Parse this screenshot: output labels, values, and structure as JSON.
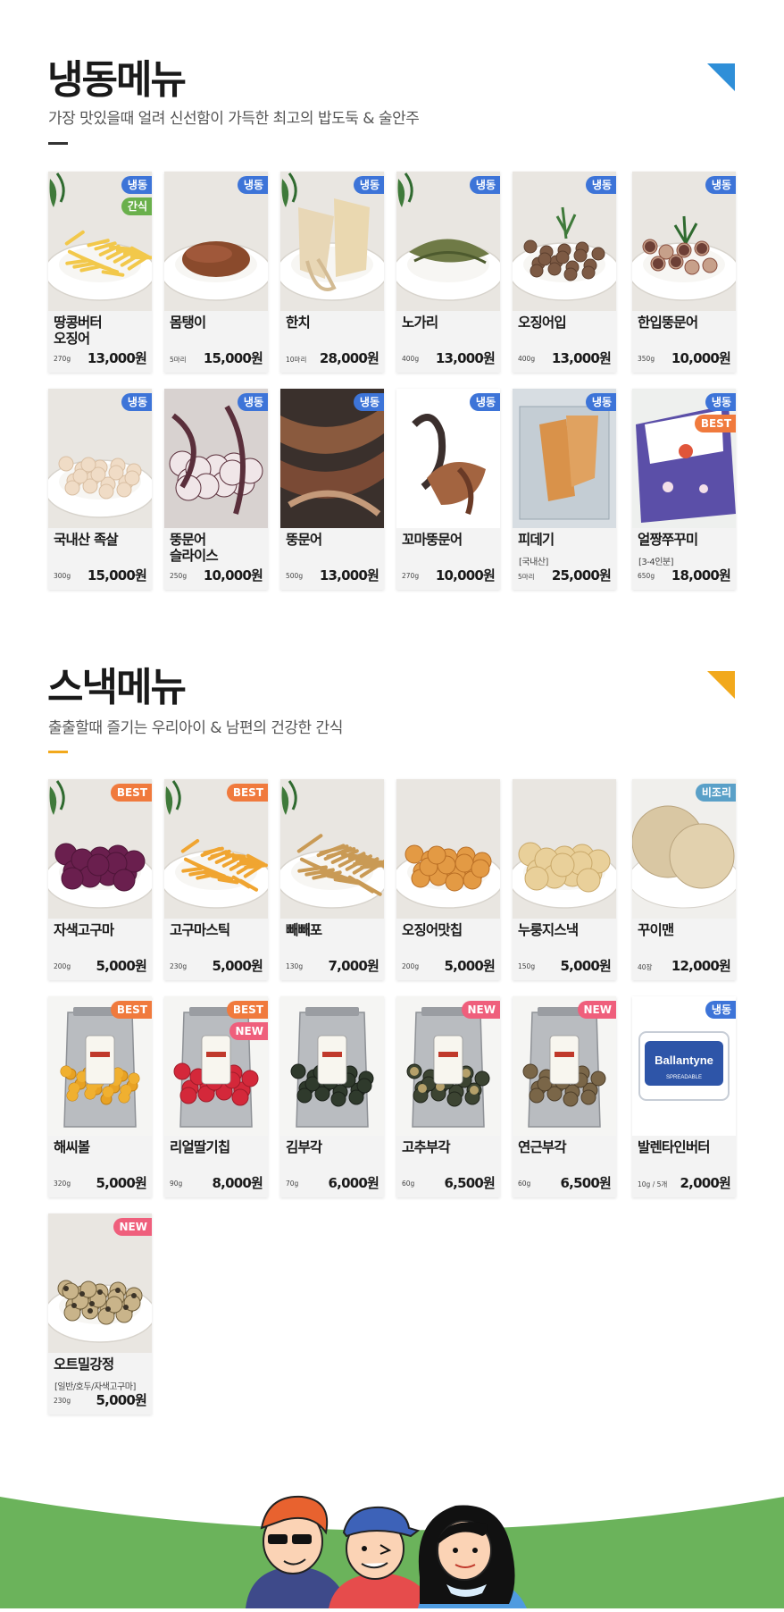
{
  "frozen": {
    "title": "냉동메뉴",
    "subtitle": "가장 맛있을때 얼려 신선함이 가득한 최고의 밥도둑 & 술안주",
    "accent": "#2f8fd8",
    "items": [
      {
        "name": "땅콩버터\n오징어",
        "weight": "270g",
        "price": "13,000원",
        "badges": [
          {
            "text": "냉동",
            "color": "#3d74d8"
          },
          {
            "text": "간식",
            "color": "#6ab04c"
          }
        ],
        "image": "butter-squid-snack",
        "note": ""
      },
      {
        "name": "몸탱이",
        "weight": "5마리",
        "price": "15,000원",
        "badges": [
          {
            "text": "냉동",
            "color": "#3d74d8"
          }
        ],
        "image": "squid-body",
        "note": ""
      },
      {
        "name": "한치",
        "weight": "10마리",
        "price": "28,000원",
        "badges": [
          {
            "text": "냉동",
            "color": "#3d74d8"
          }
        ],
        "image": "dried-squid",
        "note": ""
      },
      {
        "name": "노가리",
        "weight": "400g",
        "price": "13,000원",
        "badges": [
          {
            "text": "냉동",
            "color": "#3d74d8"
          }
        ],
        "image": "dried-pollack",
        "note": ""
      },
      {
        "name": "오징어입",
        "weight": "400g",
        "price": "13,000원",
        "badges": [
          {
            "text": "냉동",
            "color": "#3d74d8"
          }
        ],
        "image": "squid-mouth",
        "note": ""
      },
      {
        "name": "한입뚱문어",
        "weight": "350g",
        "price": "10,000원",
        "badges": [
          {
            "text": "냉동",
            "color": "#3d74d8"
          }
        ],
        "image": "octopus-bites",
        "note": ""
      },
      {
        "name": "국내산 족살",
        "weight": "300g",
        "price": "15,000원",
        "badges": [
          {
            "text": "냉동",
            "color": "#3d74d8"
          }
        ],
        "image": "shredded-meat",
        "note": ""
      },
      {
        "name": "뚱문어\n슬라이스",
        "weight": "250g",
        "price": "10,000원",
        "badges": [
          {
            "text": "냉동",
            "color": "#3d74d8"
          }
        ],
        "image": "octopus-slices",
        "note": ""
      },
      {
        "name": "뚱문어",
        "weight": "500g",
        "price": "13,000원",
        "badges": [
          {
            "text": "냉동",
            "color": "#3d74d8"
          }
        ],
        "image": "octopus-legs",
        "note": ""
      },
      {
        "name": "꼬마뚱문어",
        "weight": "270g",
        "price": "10,000원",
        "badges": [
          {
            "text": "냉동",
            "color": "#3d74d8"
          }
        ],
        "image": "baby-octopus",
        "note": ""
      },
      {
        "name": "피데기",
        "weight": "5마리",
        "price": "25,000원",
        "badges": [
          {
            "text": "냉동",
            "color": "#3d74d8"
          }
        ],
        "image": "half-dried-squid",
        "note": "[국내산]"
      },
      {
        "name": "얼짱쭈꾸미",
        "weight": "650g",
        "price": "18,000원",
        "badges": [
          {
            "text": "냉동",
            "color": "#3d74d8"
          },
          {
            "text": "BEST",
            "color": "#f07a3d"
          }
        ],
        "image": "webfoot-octopus-pack",
        "note": "[3-4인분]"
      }
    ]
  },
  "snack": {
    "title": "스낵메뉴",
    "subtitle": "출출할때 즐기는 우리아이 & 남편의 건강한 간식",
    "accent": "#f2a91c",
    "items": [
      {
        "name": "자색고구마",
        "weight": "200g",
        "price": "5,000원",
        "badges": [
          {
            "text": "BEST",
            "color": "#f07a3d"
          }
        ],
        "image": "purple-sweet-potato-chips",
        "note": ""
      },
      {
        "name": "고구마스틱",
        "weight": "230g",
        "price": "5,000원",
        "badges": [
          {
            "text": "BEST",
            "color": "#f07a3d"
          }
        ],
        "image": "sweet-potato-sticks",
        "note": ""
      },
      {
        "name": "빼빼포",
        "weight": "130g",
        "price": "7,000원",
        "badges": [],
        "image": "fish-jerky-strips",
        "note": ""
      },
      {
        "name": "오징어맛칩",
        "weight": "200g",
        "price": "5,000원",
        "badges": [],
        "image": "squid-chips",
        "note": ""
      },
      {
        "name": "누룽지스낵",
        "weight": "150g",
        "price": "5,000원",
        "badges": [],
        "image": "rice-crackers",
        "note": ""
      },
      {
        "name": "꾸이맨",
        "weight": "40장",
        "price": "12,000원",
        "badges": [
          {
            "text": "비조리",
            "color": "#5aa0c8"
          }
        ],
        "image": "fish-sheets",
        "note": ""
      },
      {
        "name": "해씨볼",
        "weight": "320g",
        "price": "5,000원",
        "badges": [
          {
            "text": "BEST",
            "color": "#f07a3d"
          }
        ],
        "image": "cereal-balls-pack",
        "note": ""
      },
      {
        "name": "리얼딸기칩",
        "weight": "90g",
        "price": "8,000원",
        "badges": [
          {
            "text": "BEST",
            "color": "#f07a3d"
          },
          {
            "text": "NEW",
            "color": "#ef5f7c"
          }
        ],
        "image": "strawberry-chips-pack",
        "note": ""
      },
      {
        "name": "김부각",
        "weight": "70g",
        "price": "6,000원",
        "badges": [],
        "image": "seaweed-chips-pack",
        "note": ""
      },
      {
        "name": "고추부각",
        "weight": "60g",
        "price": "6,500원",
        "badges": [
          {
            "text": "NEW",
            "color": "#ef5f7c"
          }
        ],
        "image": "pepper-chips-pack",
        "note": ""
      },
      {
        "name": "연근부각",
        "weight": "60g",
        "price": "6,500원",
        "badges": [
          {
            "text": "NEW",
            "color": "#ef5f7c"
          }
        ],
        "image": "lotus-root-chips-pack",
        "note": ""
      },
      {
        "name": "발렌타인버터",
        "weight": "10g / 5개",
        "price": "2,000원",
        "badges": [
          {
            "text": "냉동",
            "color": "#3d74d8"
          }
        ],
        "image": "butter-box",
        "note": "",
        "label": "Ballantyne",
        "label2": "SPREADABLE"
      },
      {
        "name": "오트밀강정",
        "weight": "230g",
        "price": "5,000원",
        "badges": [
          {
            "text": "NEW",
            "color": "#ef5f7c"
          }
        ],
        "image": "oatmeal-bars",
        "note": "[일반/호두/자색고구마]"
      }
    ]
  },
  "footer": {
    "grass_color": "#6bb35b"
  }
}
